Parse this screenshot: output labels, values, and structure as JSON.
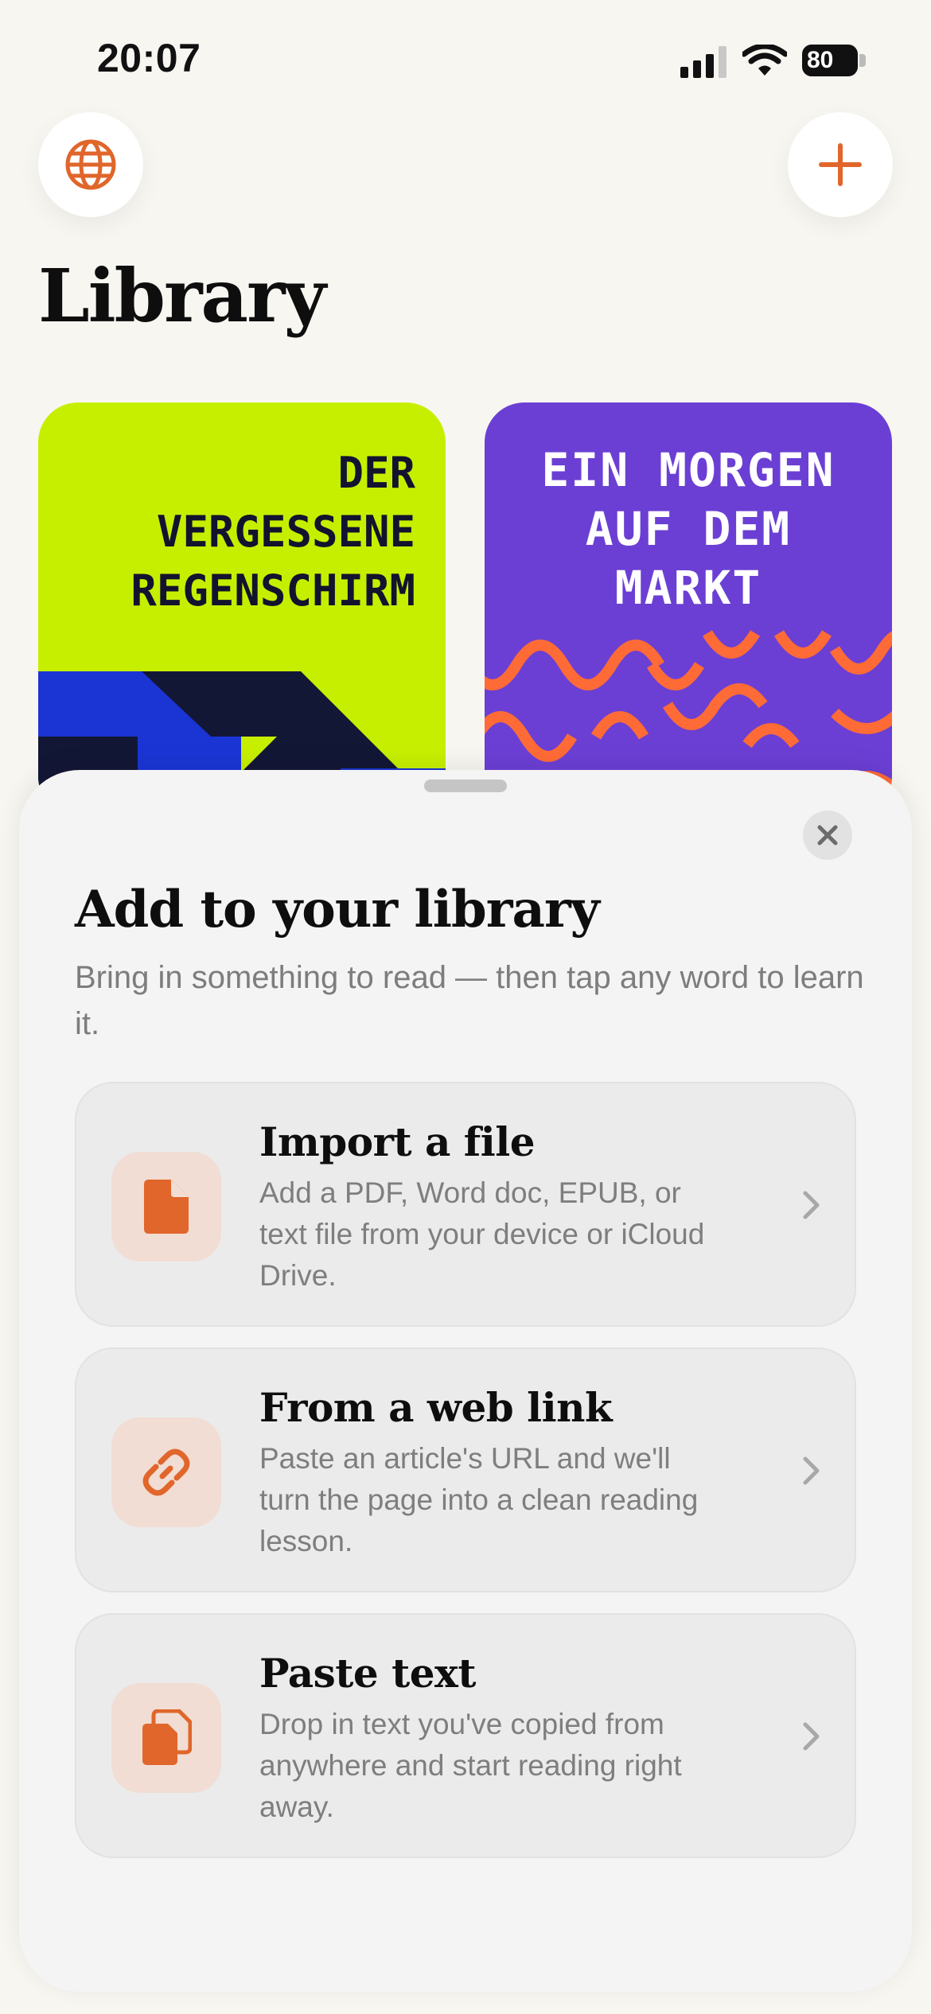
{
  "status_bar": {
    "time": "20:07",
    "battery": "80"
  },
  "header": {
    "title": "Library",
    "globe_icon": "globe-icon",
    "plus_icon": "plus-icon"
  },
  "books": [
    {
      "title_lines": [
        "DER",
        "VERGESSENE",
        "REGENSCHIRM"
      ],
      "color": "#c6ef00"
    },
    {
      "title_lines": [
        "EIN MORGEN",
        "AUF DEM",
        "MARKT"
      ],
      "color": "#6b3fd4"
    }
  ],
  "sheet": {
    "title": "Add to your library",
    "subtitle": "Bring in something to read — then tap any word to learn it.",
    "options": [
      {
        "icon": "file-icon",
        "title": "Import a file",
        "description": "Add a PDF, Word doc, EPUB, or text file from your device or iCloud Drive."
      },
      {
        "icon": "link-icon",
        "title": "From a web link",
        "description": "Paste an article's URL and we'll turn the page into a clean reading lesson."
      },
      {
        "icon": "clipboard-icon",
        "title": "Paste text",
        "description": "Drop in text you've copied from anywhere and start reading right away."
      }
    ]
  },
  "colors": {
    "accent": "#e0662b",
    "background": "#f8f6f1",
    "sheet": "#f4f4f4"
  }
}
